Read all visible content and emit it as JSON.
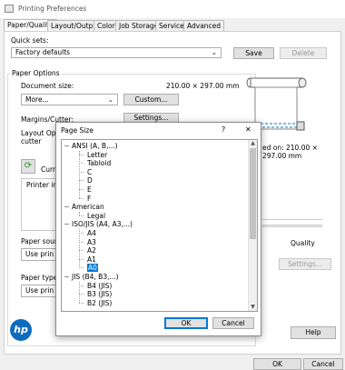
{
  "window": {
    "title": "Printing Preferences"
  },
  "tabs": [
    "Paper/Quality",
    "Layout/Output",
    "Color",
    "Job Storage",
    "Services",
    "Advanced"
  ],
  "quick_sets": {
    "label": "Quick sets:",
    "value": "Factory defaults",
    "save": "Save",
    "delete": "Delete"
  },
  "paper_options": {
    "group_label": "Paper Options",
    "document_size_label": "Document size:",
    "document_size_value": "210.00 × 297.00 mm",
    "size_select": "More...",
    "custom_button": "Custom...",
    "margins_label": "Margins/Cutter:",
    "settings_button": "Settings...",
    "layout_label_1": "Layout Optio",
    "layout_label_2": "cutter",
    "current_label": "Curr",
    "printer_info": "Printer inf",
    "paper_source_label": "Paper sourc",
    "paper_source_value": "Use prin",
    "paper_type_label": "Paper type:",
    "paper_type_value": "Use prin"
  },
  "preview": {
    "printed_on": "ed on: 210.00 × 297.00 mm"
  },
  "quality": {
    "label": "Quality",
    "settings_button": "Settings..."
  },
  "footer": {
    "help": "Help",
    "ok": "OK",
    "cancel": "Cancel"
  },
  "dialog": {
    "title": "Page Size",
    "help_glyph": "?",
    "close_glyph": "✕",
    "ok": "OK",
    "cancel": "Cancel",
    "groups": [
      {
        "name": "ANSI (A, B,...)",
        "items": [
          "Letter",
          "Tabloid",
          "C",
          "D",
          "E",
          "F"
        ]
      },
      {
        "name": "American",
        "items": [
          "Legal"
        ]
      },
      {
        "name": "ISO/JIS (A4, A3,...)",
        "items": [
          "A4",
          "A3",
          "A2",
          "A1",
          "A0"
        ]
      },
      {
        "name": "JIS (B4, B3,...)",
        "items": [
          "B4 (JIS)",
          "B3 (JIS)",
          "B2 (JIS)"
        ]
      }
    ],
    "selected": "A0"
  },
  "colors": {
    "accent": "#0078d7",
    "hp_logo": "#0f6cbd",
    "selection": "#0078d7"
  }
}
